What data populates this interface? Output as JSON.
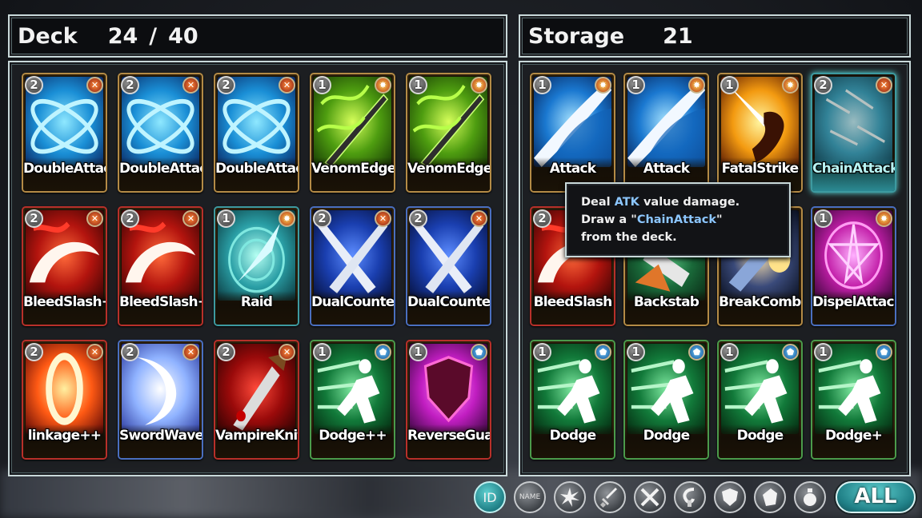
{
  "deck": {
    "title": "Deck",
    "count": "24",
    "separator": "/",
    "max": "40",
    "cards": [
      {
        "name": "DoubleAttack",
        "cost": "2",
        "type": "attack",
        "art": "x-blue"
      },
      {
        "name": "DoubleAttack",
        "cost": "2",
        "type": "attack",
        "art": "x-blue"
      },
      {
        "name": "DoubleAttack",
        "cost": "2",
        "type": "attack",
        "art": "x-blue"
      },
      {
        "name": "VenomEdge",
        "cost": "1",
        "type": "skill",
        "art": "venom"
      },
      {
        "name": "VenomEdge",
        "cost": "1",
        "type": "skill",
        "art": "venom"
      },
      {
        "name": "BleedSlash+",
        "cost": "2",
        "type": "attack",
        "art": "bleed"
      },
      {
        "name": "BleedSlash++",
        "cost": "2",
        "type": "attack",
        "art": "bleed"
      },
      {
        "name": "Raid",
        "cost": "1",
        "type": "skill",
        "art": "raid"
      },
      {
        "name": "DualCounter",
        "cost": "2",
        "type": "attack",
        "art": "dual"
      },
      {
        "name": "DualCounter",
        "cost": "2",
        "type": "attack",
        "art": "dual"
      },
      {
        "name": "linkage++",
        "cost": "2",
        "type": "attack",
        "art": "link"
      },
      {
        "name": "SwordWave",
        "cost": "2",
        "type": "attack",
        "art": "wave"
      },
      {
        "name": "VampireKnife",
        "cost": "2",
        "type": "attack",
        "art": "vamp"
      },
      {
        "name": "Dodge++",
        "cost": "1",
        "type": "defend",
        "art": "dodge"
      },
      {
        "name": "ReverseGuard",
        "cost": "1",
        "type": "defend",
        "art": "guard"
      }
    ]
  },
  "storage": {
    "title": "Storage",
    "count": "21",
    "cards": [
      {
        "name": "Attack",
        "cost": "1",
        "type": "skill",
        "art": "slash"
      },
      {
        "name": "Attack",
        "cost": "1",
        "type": "skill",
        "art": "slash"
      },
      {
        "name": "FatalStrike",
        "cost": "1",
        "type": "skill",
        "art": "fatal"
      },
      {
        "name": "ChainAttack",
        "cost": "2",
        "type": "attack",
        "art": "chain",
        "selected": true
      },
      {
        "name": "BleedSlash",
        "cost": "2",
        "type": "attack",
        "art": "bleed"
      },
      {
        "name": "Backstab",
        "cost": "",
        "type": "",
        "art": "backstab"
      },
      {
        "name": "BreakCombo",
        "cost": "",
        "type": "",
        "art": "break"
      },
      {
        "name": "DispelAttack+",
        "cost": "1",
        "type": "skill",
        "art": "dispel"
      },
      {
        "name": "Dodge",
        "cost": "1",
        "type": "defend",
        "art": "dodge"
      },
      {
        "name": "Dodge",
        "cost": "1",
        "type": "defend",
        "art": "dodge"
      },
      {
        "name": "Dodge",
        "cost": "1",
        "type": "defend",
        "art": "dodge"
      },
      {
        "name": "Dodge+",
        "cost": "1",
        "type": "defend",
        "art": "dodge"
      }
    ]
  },
  "tooltip": {
    "line1_pre": "Deal ",
    "line1_hl": "ATK",
    "line1_post": " value damage.",
    "line2_pre": "Draw a \"",
    "line2_hl": "ChainAttack",
    "line2_post": "\"",
    "line3": "from the deck."
  },
  "filters": {
    "id_label": "ID",
    "name_label": "NAME",
    "all_label": "ALL",
    "icons": [
      "burst-icon",
      "sword-icon",
      "crossed-swords-icon",
      "hook-icon",
      "shield-icon",
      "armor-icon",
      "potion-icon"
    ]
  }
}
